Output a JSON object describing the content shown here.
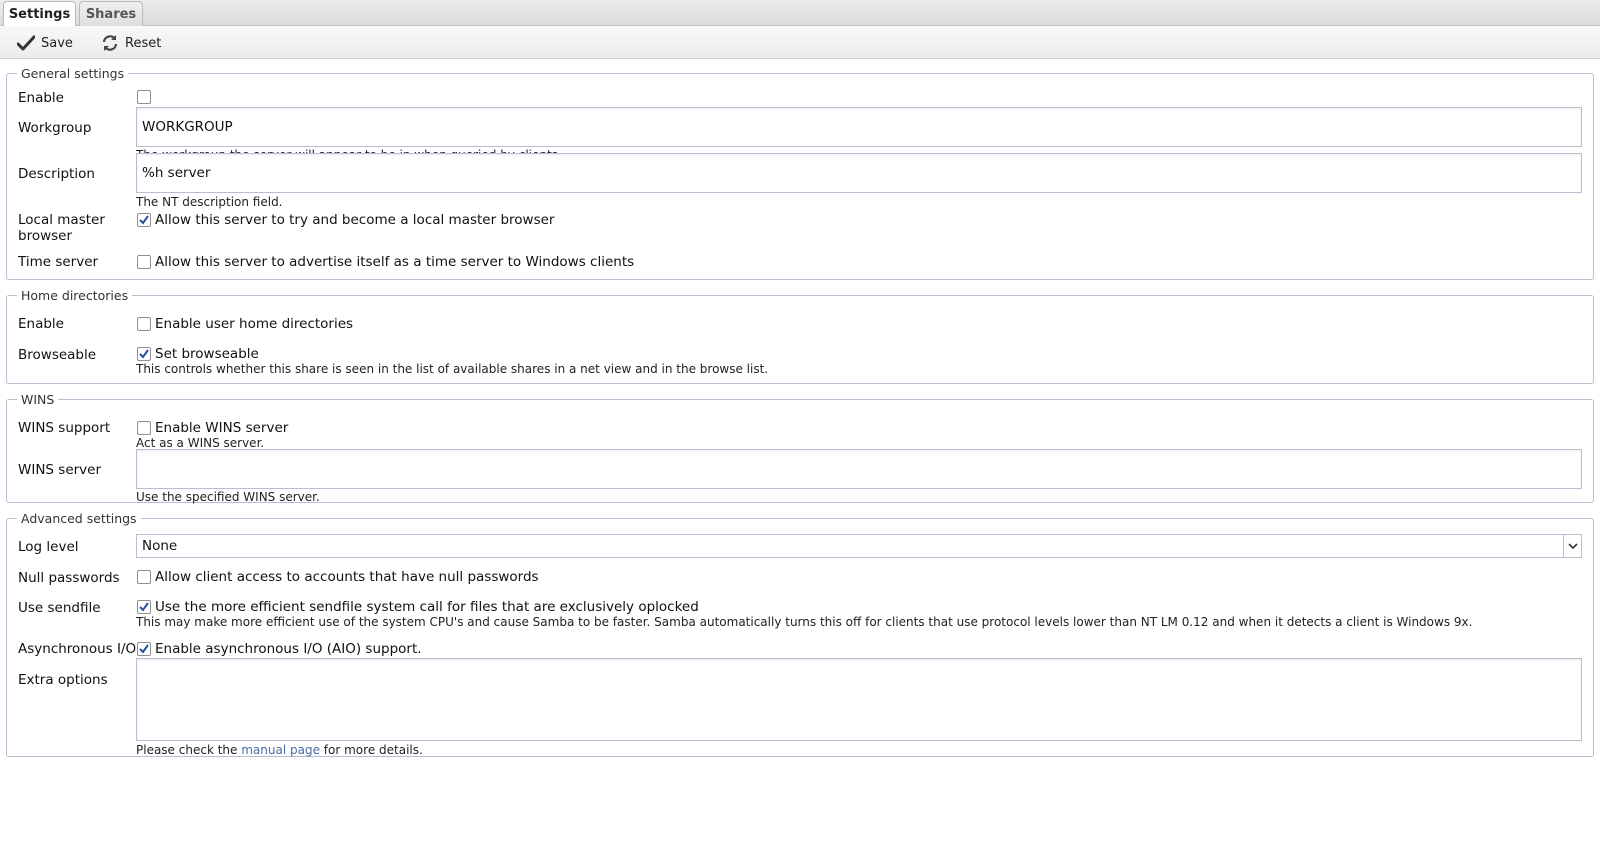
{
  "tabs": [
    {
      "label": "Settings",
      "active": true
    },
    {
      "label": "Shares",
      "active": false
    }
  ],
  "toolbar": {
    "save_label": "Save",
    "reset_label": "Reset"
  },
  "general": {
    "legend": "General settings",
    "enable_label": "Enable",
    "enable_checked": false,
    "workgroup_label": "Workgroup",
    "workgroup_value": "WORKGROUP",
    "workgroup_hint": "The workgroup the server will appear to be in when queried by clients.",
    "description_label": "Description",
    "description_value": "%h server",
    "description_hint": "The NT description field.",
    "local_master_label_1": "Local master",
    "local_master_label_2": "browser",
    "local_master_text": "Allow this server to try and become a local master browser",
    "local_master_checked": true,
    "time_server_label": "Time server",
    "time_server_text": "Allow this server to advertise itself as a time server to Windows clients",
    "time_server_checked": false
  },
  "home": {
    "legend": "Home directories",
    "enable_label": "Enable",
    "enable_text": "Enable user home directories",
    "enable_checked": false,
    "browseable_label": "Browseable",
    "browseable_text": "Set browseable",
    "browseable_checked": true,
    "browseable_hint": "This controls whether this share is seen in the list of available shares in a net view and in the browse list."
  },
  "wins": {
    "legend": "WINS",
    "support_label": "WINS support",
    "support_text": "Enable WINS server",
    "support_checked": false,
    "support_hint": "Act as a WINS server.",
    "server_label": "WINS server",
    "server_value": "",
    "server_hint": "Use the specified WINS server."
  },
  "advanced": {
    "legend": "Advanced settings",
    "log_level_label": "Log level",
    "log_level_value": "None",
    "null_passwords_label": "Null passwords",
    "null_passwords_text": "Allow client access to accounts that have null passwords",
    "null_passwords_checked": false,
    "sendfile_label": "Use sendfile",
    "sendfile_text": "Use the more efficient sendfile system call for files that are exclusively oplocked",
    "sendfile_checked": true,
    "sendfile_hint": "This may make more efficient use of the system CPU's and cause Samba to be faster. Samba automatically turns this off for clients that use protocol levels lower than NT LM 0.12 and when it detects a client is Windows 9x.",
    "aio_label": "Asynchronous I/O",
    "aio_text": "Enable asynchronous I/O (AIO) support.",
    "aio_checked": true,
    "extra_label": "Extra options",
    "extra_value": "",
    "extra_hint_before": "Please check the",
    "extra_hint_link": "manual page",
    "extra_hint_after": "for more details."
  }
}
